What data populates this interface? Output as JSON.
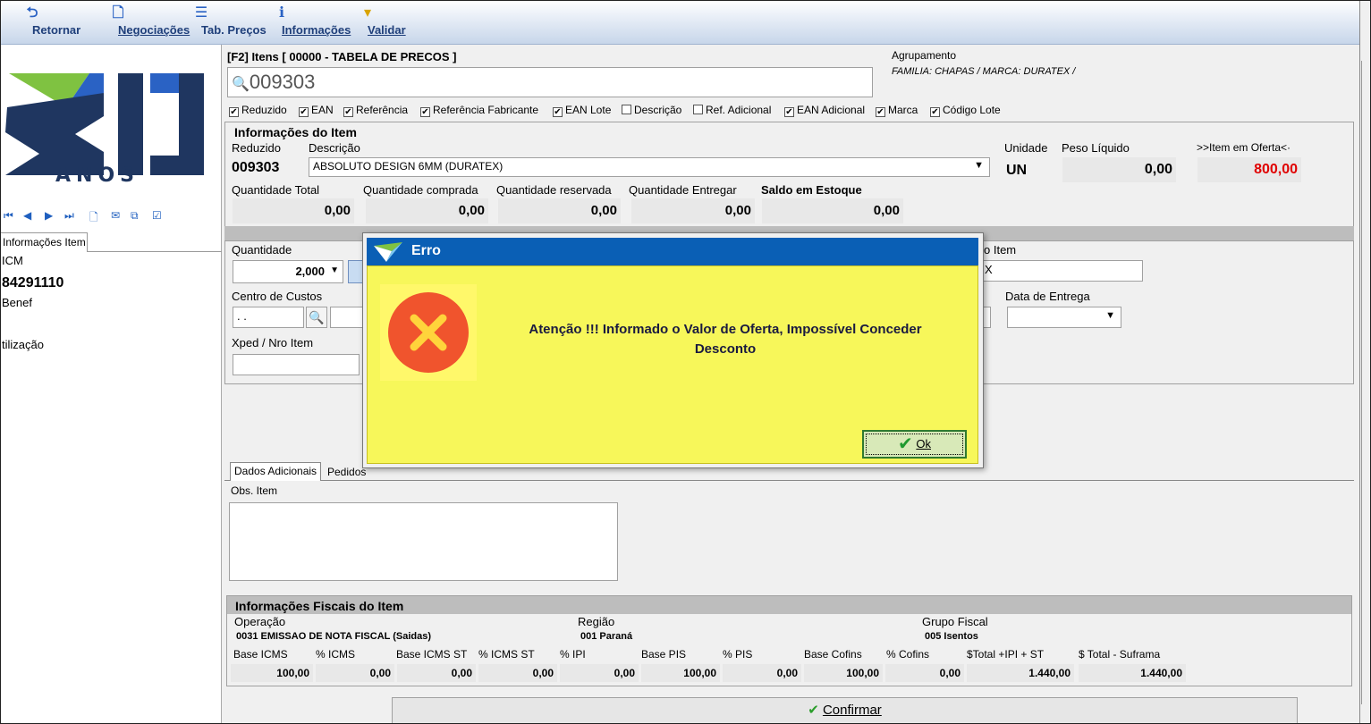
{
  "toolbar": {
    "retornar": "Retornar",
    "negociacoes": "Negociações",
    "tab_precos": "Tab. Preços",
    "informacoes": "Informações",
    "validar": "Validar"
  },
  "logo": {
    "text": "ANOS"
  },
  "left": {
    "tab": "Informações Item",
    "icm": "ICM",
    "code": "84291110",
    "benef": "Benef",
    "utilizacao": "tilização"
  },
  "items": {
    "header": "[F2] Itens [ 00000 - TABELA DE PRECOS ]",
    "search_value": "009303",
    "agrupamento_label": "Agrupamento",
    "agrupamento_value": "FAMILIA: CHAPAS / MARCA: DURATEX /",
    "checkboxes": [
      {
        "label": "Reduzido",
        "checked": "✔"
      },
      {
        "label": "EAN",
        "checked": "✔"
      },
      {
        "label": "Referência",
        "checked": "✔"
      },
      {
        "label": "Referência Fabricante",
        "checked": "✔"
      },
      {
        "label": "EAN Lote",
        "checked": "✔"
      },
      {
        "label": "Descrição",
        "checked": ""
      },
      {
        "label": "Ref. Adicional",
        "checked": ""
      },
      {
        "label": "EAN Adicional",
        "checked": "✔"
      },
      {
        "label": "Marca",
        "checked": "✔"
      },
      {
        "label": "Código Lote",
        "checked": "✔"
      }
    ]
  },
  "info": {
    "title": "Informações do Item",
    "reduzido_label": "Reduzido",
    "reduzido_value": "009303",
    "descricao_label": "Descrição",
    "descricao_value": "ABSOLUTO DESIGN 6MM (DURATEX)",
    "unidade_label": "Unidade",
    "unidade_value": "UN",
    "peso_label": "Peso Líquido",
    "peso_value": "0,00",
    "oferta_label": ">>Item em Oferta<·",
    "oferta_value": "800,00",
    "qtd_total_label": "Quantidade Total",
    "qtd_total_value": "0,00",
    "qtd_comprada_label": "Quantidade comprada",
    "qtd_comprada_value": "0,00",
    "qtd_reservada_label": "Quantidade reservada",
    "qtd_reservada_value": "0,00",
    "qtd_entregar_label": "Quantidade Entregar",
    "qtd_entregar_value": "0,00",
    "saldo_label": "Saldo em Estoque",
    "saldo_value": "0,00"
  },
  "form": {
    "quantidade_label": "Quantidade",
    "quantidade_value": "2,000",
    "tipo_item_label": "o Item",
    "tipo_item_value": "X",
    "centro_label": "Centro de Custos",
    "centro_value": ". .",
    "data_entrega_label": "Data de Entrega",
    "xped_label": "Xped / Nro Item"
  },
  "tabs": {
    "dados": "Dados Adicionais",
    "pedidos": "Pedidos"
  },
  "obs": {
    "label": "Obs. Item"
  },
  "fiscal": {
    "title": "Informações Fiscais do Item",
    "operacao_label": "Operação",
    "operacao_value": "0031  EMISSAO DE NOTA FISCAL (Saidas)",
    "regiao_label": "Região",
    "regiao_value": "001   Paraná",
    "grupo_label": "Grupo Fiscal",
    "grupo_value": "005   Isentos",
    "cols": [
      {
        "label": "Base ICMS",
        "value": "100,00"
      },
      {
        "label": "% ICMS",
        "value": "0,00"
      },
      {
        "label": "Base ICMS ST",
        "value": "0,00"
      },
      {
        "label": "% ICMS ST",
        "value": "0,00"
      },
      {
        "label": "% IPI",
        "value": "0,00"
      },
      {
        "label": "Base PIS",
        "value": "100,00"
      },
      {
        "label": "% PIS",
        "value": "0,00"
      },
      {
        "label": "Base Cofins",
        "value": "100,00"
      },
      {
        "label": "% Cofins",
        "value": "0,00"
      },
      {
        "label": "$Total +IPI + ST",
        "value": "1.440,00"
      },
      {
        "label": "$ Total - Suframa",
        "value": "1.440,00"
      }
    ]
  },
  "confirm": {
    "label": "Confirmar"
  },
  "dialog": {
    "title": "Erro",
    "message": "Atenção !!! Informado o Valor de Oferta, Impossível Conceder Desconto",
    "ok": "Ok"
  }
}
